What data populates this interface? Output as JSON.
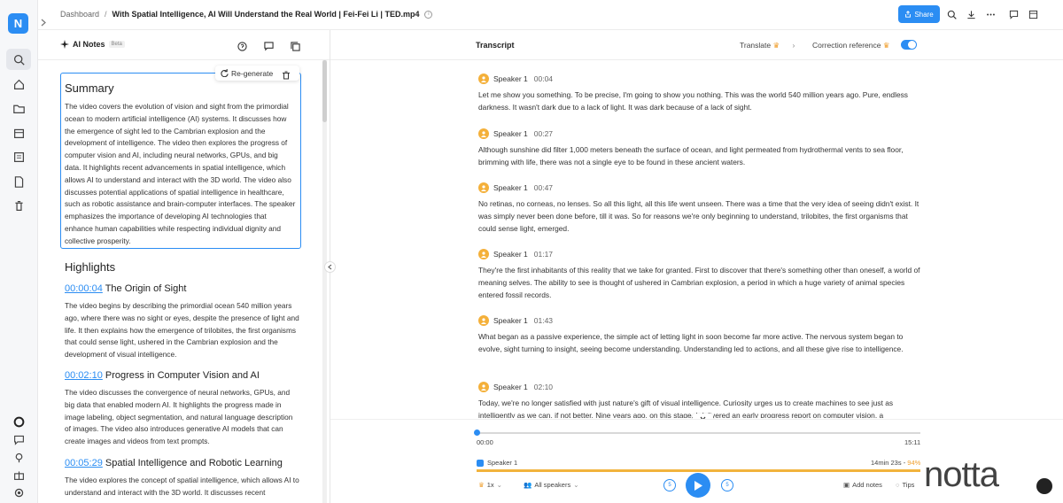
{
  "app": {
    "logo_letter": "N",
    "accent_color": "#2b8df3"
  },
  "rail": {
    "icons": [
      "search-icon",
      "home-icon",
      "folder-icon",
      "calendar-icon",
      "notes-icon",
      "document-icon",
      "trash-icon"
    ],
    "bottom_icons": [
      "record-icon",
      "chat-icon",
      "location-icon",
      "gift-icon",
      "settings-icon"
    ]
  },
  "topbar": {
    "breadcrumb_root": "Dashboard",
    "separator": "/",
    "document_title": "With Spatial Intelligence, AI Will Understand the Real World | Fei-Fei Li | TED.mp4",
    "info_glyph": "i",
    "share_label": "Share"
  },
  "notes_panel": {
    "title": "AI Notes",
    "badge": "Beta",
    "regenerate_label": "Re-generate",
    "summary": {
      "heading": "Summary",
      "text": "The video covers the evolution of vision and sight from the primordial ocean to modern artificial intelligence (AI) systems. It discusses how the emergence of sight led to the Cambrian explosion and the development of intelligence. The video then explores the progress of computer vision and AI, including neural networks, GPUs, and big data. It highlights recent advancements in spatial intelligence, which allows AI to understand and interact with the 3D world. The video also discusses potential applications of spatial intelligence in healthcare, such as robotic assistance and brain-computer interfaces. The speaker emphasizes the importance of developing AI technologies that enhance human capabilities while respecting individual dignity and collective prosperity."
    },
    "highlights_heading": "Highlights",
    "highlights": [
      {
        "time": "00:00:04",
        "title": "The Origin of Sight",
        "text": "The video begins by describing the primordial ocean 540 million years ago, where there was no sight or eyes, despite the presence of light and life. It then explains how the emergence of trilobites, the first organisms that could sense light, ushered in the Cambrian explosion and the development of visual intelligence."
      },
      {
        "time": "00:02:10",
        "title": "Progress in Computer Vision and AI",
        "text": "The video discusses the convergence of neural networks, GPUs, and big data that enabled modern AI. It highlights the progress made in image labeling, object segmentation, and natural language description of images. The video also introduces generative AI models that can create images and videos from text prompts."
      },
      {
        "time": "00:05:29",
        "title": "Spatial Intelligence and Robotic Learning",
        "text": "The video explores the concept of spatial intelligence, which allows AI to understand and interact with the 3D world. It discusses recent"
      }
    ]
  },
  "transcript": {
    "title": "Transcript",
    "translate_label": "Translate",
    "correction_label": "Correction reference",
    "correction_enabled": true,
    "segments": [
      {
        "speaker": "Speaker 1",
        "time": "00:04",
        "text": "Let me show you something. To be precise, I'm going to show you nothing. This was the world 540 million years ago. Pure, endless darkness. It wasn't dark due to a lack of light. It was dark because of a lack of sight."
      },
      {
        "speaker": "Speaker 1",
        "time": "00:27",
        "text": "Although sunshine did filter 1,000 meters beneath the surface of ocean, and light permeated from hydrothermal vents to sea floor, brimming with life, there was not a single eye to be found in these ancient waters."
      },
      {
        "speaker": "Speaker 1",
        "time": "00:47",
        "text": "No retinas, no corneas, no lenses. So all this light, all this life went unseen. There was a time that the very idea of seeing didn't exist. It was simply never been done before, till it was. So for reasons we're only beginning to understand, trilobites, the first organisms that could sense light, emerged."
      },
      {
        "speaker": "Speaker 1",
        "time": "01:17",
        "text": "They're the first inhabitants of this reality that we take for granted. First to discover that there's something other than oneself, a world of meaning selves. The ability to see is thought of ushered in Cambrian explosion, a period in which a huge variety of animal species entered fossil records."
      },
      {
        "speaker": "Speaker 1",
        "time": "01:43",
        "text": "What began as a passive experience, the simple act of letting light in soon become far more active. The nervous system began to evolve, sight turning to insight, seeing become understanding. Understanding led to actions, and all these give rise to intelligence."
      },
      {
        "speaker": "Speaker 1",
        "time": "02:10",
        "text": "Today, we're no longer satisfied with just nature's gift of visual intelligence. Curiosity urges us to create machines to see just as intelligently as we can, if not better. Nine years ago, on this stage, I delivered an early progress report on computer vision, a"
      }
    ]
  },
  "player": {
    "current_time": "00:00",
    "total_time": "15:11",
    "progress": 0.0,
    "speaker_track": "Speaker 1",
    "speaker_duration": "14min 23s",
    "speaker_share": "94%",
    "speed": "1x",
    "speakers_filter": "All speakers",
    "skip_back": "5",
    "skip_forward": "5",
    "add_notes_label": "Add notes",
    "tips_label": "Tips"
  },
  "watermark": "notta"
}
